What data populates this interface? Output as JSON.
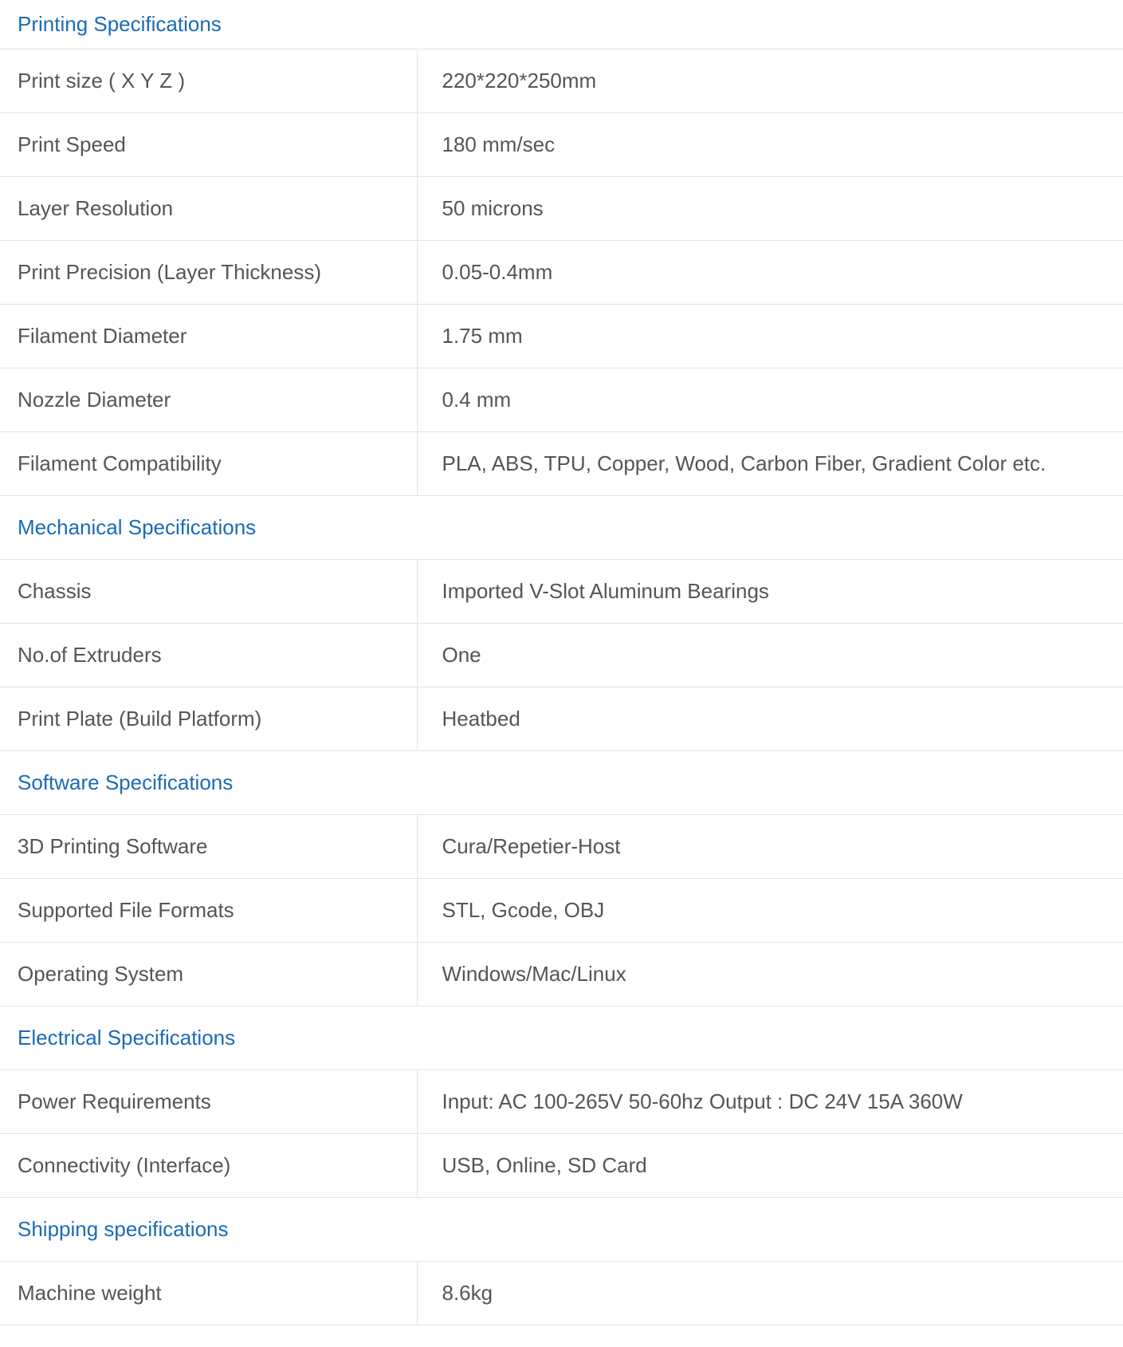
{
  "colors": {
    "section_heading": "#1a6bb5",
    "body_text": "#555555",
    "border": "#e3e3e3"
  },
  "sections": [
    {
      "title": "Printing Specifications",
      "rows": [
        {
          "label": "Print size ( X Y Z )",
          "value": "220*220*250mm"
        },
        {
          "label": "Print Speed",
          "value": "180 mm/sec"
        },
        {
          "label": "Layer Resolution",
          "value": "50 microns"
        },
        {
          "label": "Print Precision (Layer Thickness)",
          "value": "0.05-0.4mm"
        },
        {
          "label": "Filament Diameter",
          "value": "1.75 mm"
        },
        {
          "label": "Nozzle Diameter",
          "value": "0.4 mm"
        },
        {
          "label": "Filament Compatibility",
          "value": "PLA, ABS, TPU, Copper, Wood, Carbon Fiber, Gradient Color etc."
        }
      ]
    },
    {
      "title": "Mechanical Specifications",
      "rows": [
        {
          "label": "Chassis",
          "value": "Imported V-Slot Aluminum Bearings"
        },
        {
          "label": "No.of Extruders",
          "value": "One"
        },
        {
          "label": "Print Plate (Build Platform)",
          "value": "Heatbed"
        }
      ]
    },
    {
      "title": "Software Specifications",
      "rows": [
        {
          "label": "3D Printing Software",
          "value": "Cura/Repetier-Host"
        },
        {
          "label": "Supported File Formats",
          "value": "STL, Gcode, OBJ"
        },
        {
          "label": "Operating System",
          "value": "Windows/Mac/Linux"
        }
      ]
    },
    {
      "title": "Electrical Specifications",
      "rows": [
        {
          "label": "Power Requirements",
          "value": "Input: AC 100-265V 50-60hz Output : DC 24V 15A 360W"
        },
        {
          "label": "Connectivity (Interface)",
          "value": "USB, Online, SD Card"
        }
      ]
    },
    {
      "title": "Shipping specifications",
      "rows": [
        {
          "label": "Machine weight",
          "value": "8.6kg"
        }
      ]
    }
  ]
}
